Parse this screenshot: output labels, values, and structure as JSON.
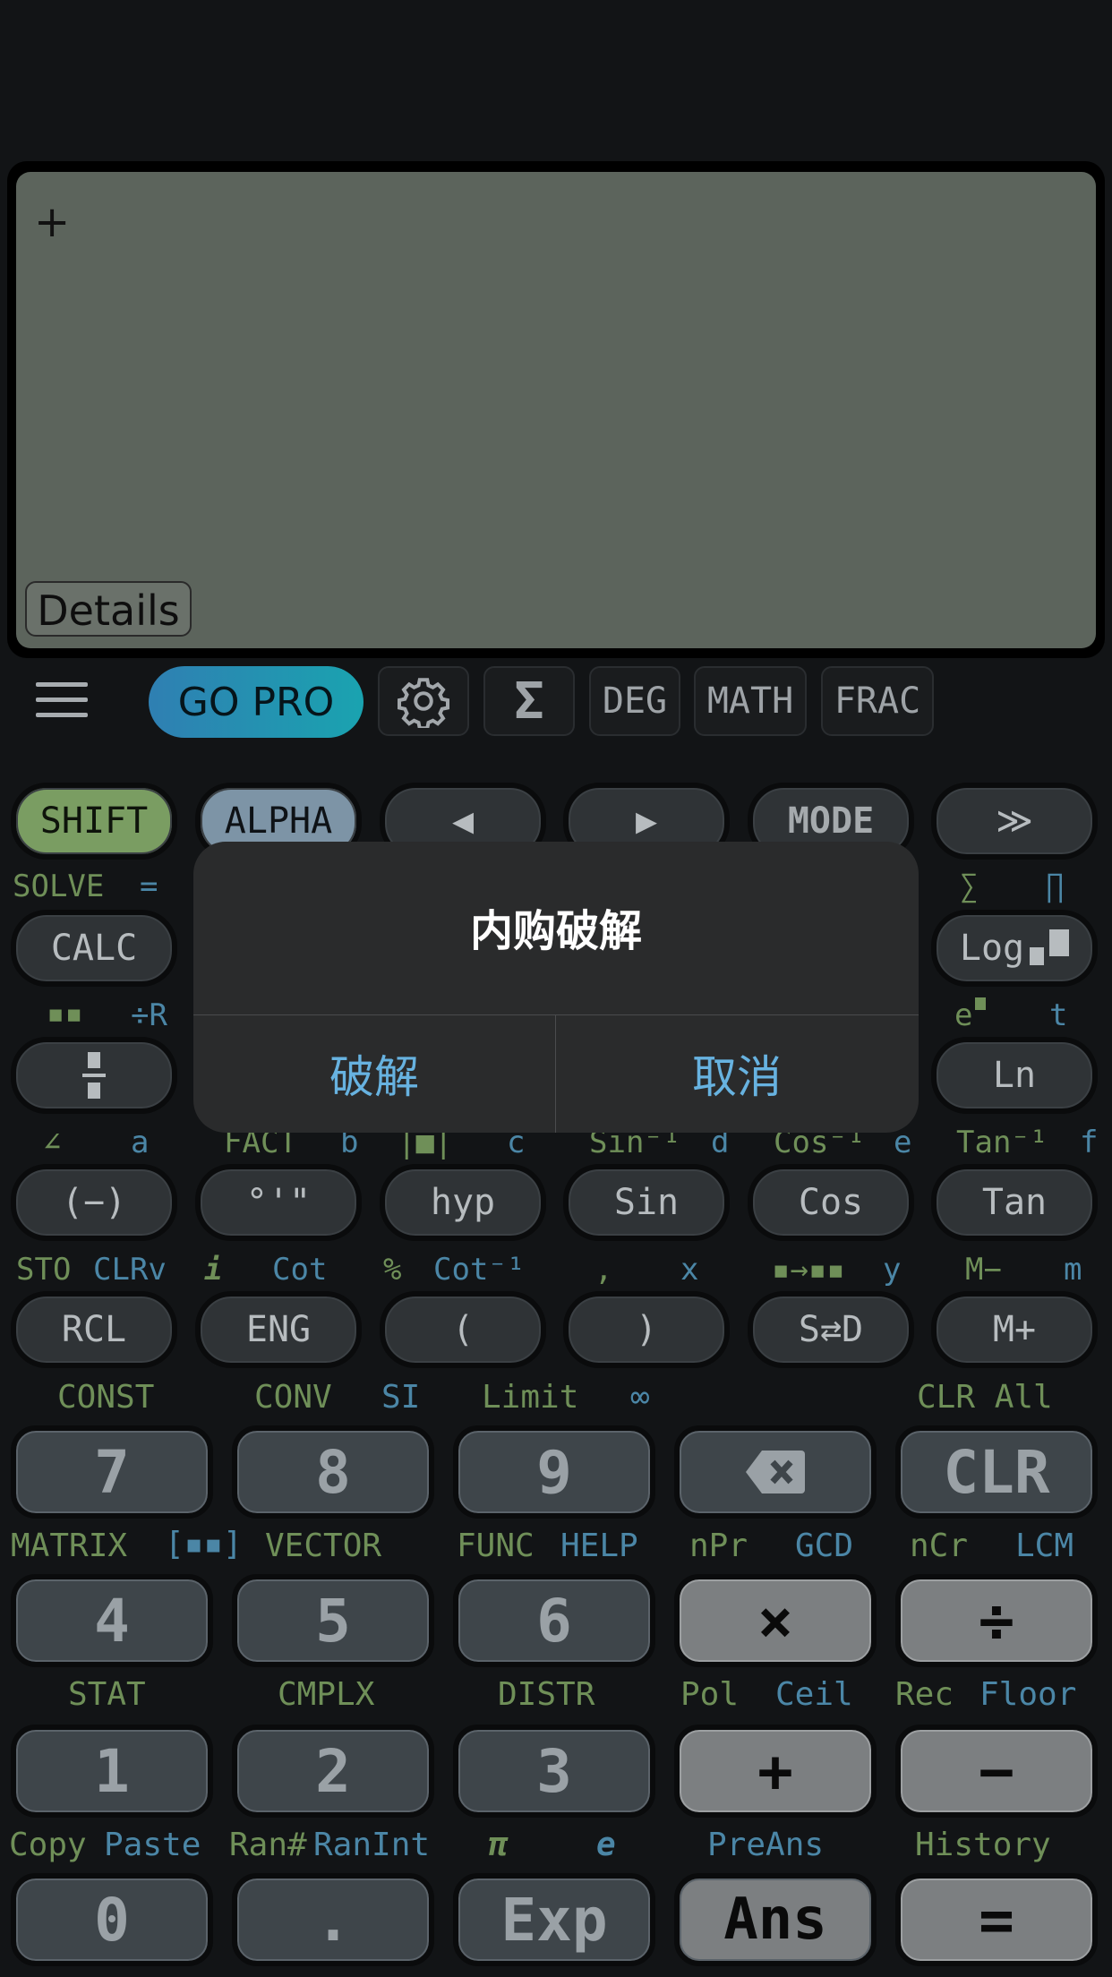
{
  "display": {
    "cursor": "+",
    "details_label": "Details"
  },
  "toolbar": {
    "gopro": "GO PRO",
    "deg": "DEG",
    "math": "MATH",
    "frac": "FRAC",
    "sigma": "Σ"
  },
  "row1": {
    "shift": "SHIFT",
    "alpha": "ALPHA",
    "left": "◀",
    "right": "▶",
    "mode": "MODE",
    "more": "≫"
  },
  "labels1": {
    "solve": "SOLVE",
    "eq": "=",
    "sum": "∑",
    "prod": "∏"
  },
  "row2": {
    "calc": "CALC",
    "log": "Log"
  },
  "labels2": {
    "div_r": "÷R",
    "e_sq": "e",
    "t": "t"
  },
  "row3": {
    "ln": "Ln"
  },
  "labels3": {
    "angle": "∠",
    "a": "a",
    "fact": "FACT",
    "b": "b",
    "abs": "|■|",
    "c": "c",
    "asin": "Sin⁻¹",
    "d": "d",
    "acos": "Cos⁻¹",
    "e": "e",
    "atan": "Tan⁻¹",
    "f": "f"
  },
  "row4": {
    "neg": "(−)",
    "deg_min_sec": "°'\"",
    "hyp": "hyp",
    "sin": "Sin",
    "cos": "Cos",
    "tan": "Tan"
  },
  "labels4": {
    "sto": "STO",
    "clrv": "CLRv",
    "i": "i",
    "cot": "Cot",
    "pct": "%",
    "acot": "Cot⁻¹",
    "comma": ",",
    "x": "x",
    "y": "y",
    "mminus": "M−",
    "m": "m"
  },
  "row5": {
    "rcl": "RCL",
    "eng": "ENG",
    "lparen": "(",
    "rparen": ")",
    "sd": "S⇄D",
    "mplus": "M+"
  },
  "labels5": {
    "const": "CONST",
    "conv": "CONV",
    "si": "SI",
    "limit": "Limit",
    "inf": "∞",
    "clrall": "CLR All"
  },
  "row6": {
    "k7": "7",
    "k8": "8",
    "k9": "9",
    "clr": "CLR"
  },
  "labels6": {
    "matrix": "MATRIX",
    "vector": "VECTOR",
    "func": "FUNC",
    "help": "HELP",
    "npr": "nPr",
    "gcd": "GCD",
    "ncr": "nCr",
    "lcm": "LCM"
  },
  "row7": {
    "k4": "4",
    "k5": "5",
    "k6": "6",
    "mul": "×",
    "div": "÷"
  },
  "labels7": {
    "stat": "STAT",
    "cmplx": "CMPLX",
    "distr": "DISTR",
    "pol": "Pol",
    "ceil": "Ceil",
    "rec": "Rec",
    "floor": "Floor"
  },
  "row8": {
    "k1": "1",
    "k2": "2",
    "k3": "3",
    "plus": "+",
    "minus": "−"
  },
  "labels8": {
    "copy": "Copy",
    "paste": "Paste",
    "ran": "Ran#",
    "ranint": "RanInt",
    "pi": "π",
    "e": "e",
    "preans": "PreAns",
    "history": "History"
  },
  "row9": {
    "k0": "0",
    "dot": ".",
    "exp": "Exp",
    "ans": "Ans",
    "equals": "="
  },
  "dialog": {
    "title": "内购破解",
    "confirm": "破解",
    "cancel": "取消"
  }
}
